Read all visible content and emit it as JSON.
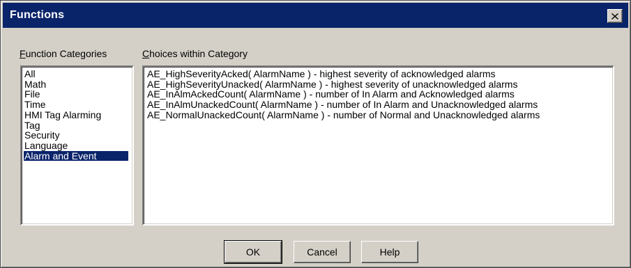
{
  "window": {
    "title": "Functions",
    "close_icon": "close-icon"
  },
  "labels": {
    "categories_mnemonic": "F",
    "categories_rest": "unction Categories",
    "choices_mnemonic": "C",
    "choices_rest": "hoices within Category"
  },
  "categories": {
    "items": [
      "All",
      "Math",
      "File",
      "Time",
      "HMI Tag Alarming",
      "Tag",
      "Security",
      "Language",
      "Alarm and Event"
    ],
    "selected": "Alarm and Event"
  },
  "choices": {
    "items": [
      "AE_HighSeverityAcked( AlarmName ) - highest severity of acknowledged alarms",
      "AE_HighSeverityUnacked( AlarmName ) - highest severity of unacknowledged alarms",
      "AE_InAlmAckedCount( AlarmName ) - number of In Alarm and Acknowledged alarms",
      "AE_InAlmUnackedCount( AlarmName ) - number of In Alarm and Unacknowledged alarms",
      "AE_NormalUnackedCount( AlarmName ) - number of Normal and Unacknowledged alarms"
    ]
  },
  "buttons": {
    "ok": "OK",
    "cancel": "Cancel",
    "help": "Help"
  },
  "colors": {
    "titlebar": "#0a246a",
    "dialog_face": "#d4d0c8",
    "selection": "#0a246a"
  }
}
